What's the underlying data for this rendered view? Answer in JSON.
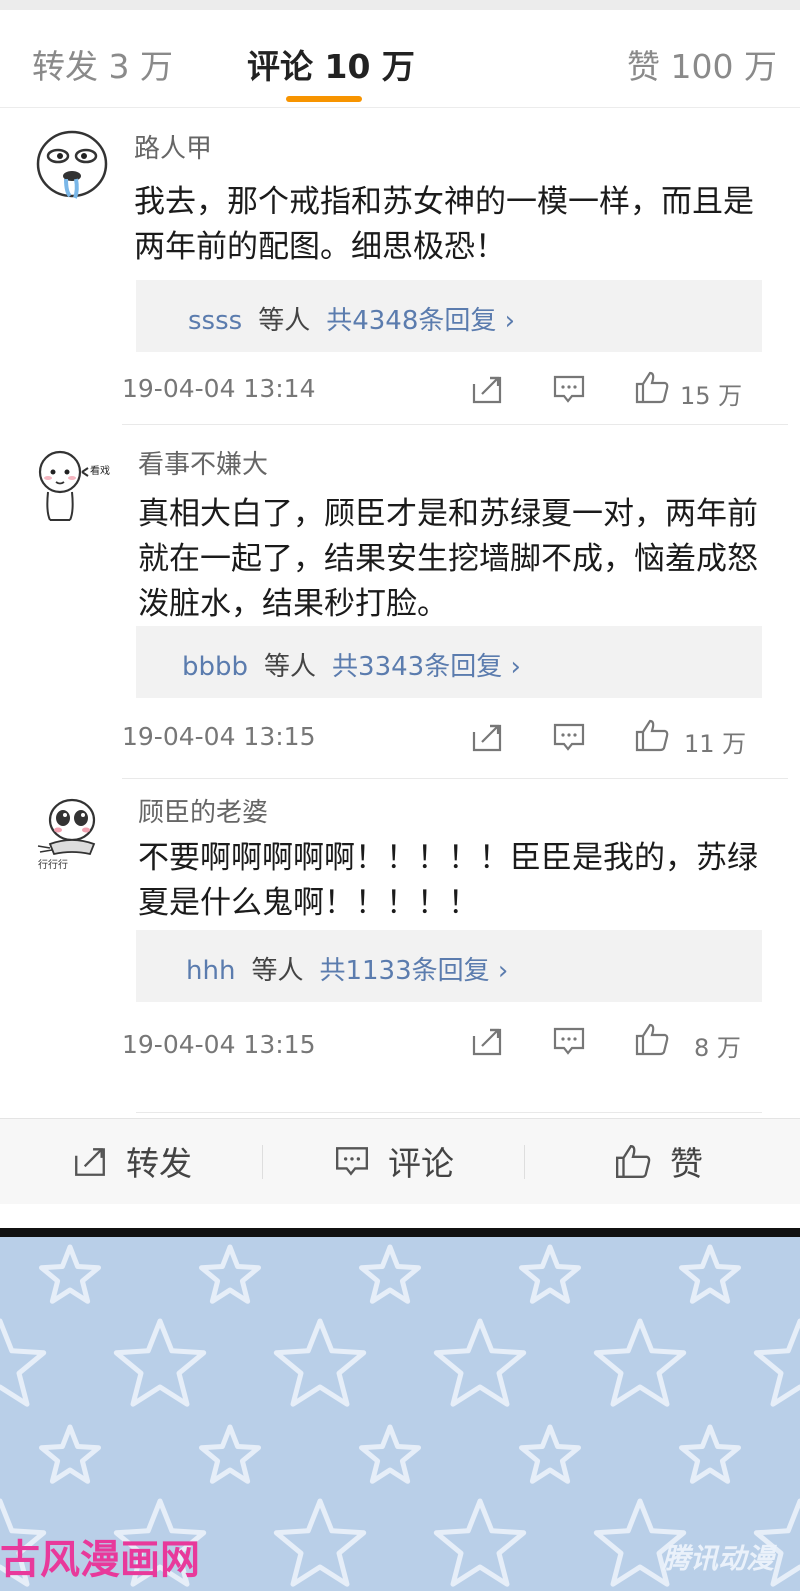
{
  "tabs": {
    "repost": "转发  3  万",
    "comment": "评论 10 万",
    "like": "赞 100  万",
    "accent": "#f79400"
  },
  "comments": [
    {
      "user": "路人甲",
      "avatar_icon": "drooling-face-icon",
      "text": "我去，那个戒指和苏女神的一模一样，而且是两年前的配图。细思极恐！",
      "reply_user": "ssss",
      "reply_others": "等人",
      "reply_count": "共4348条回复 ›",
      "time": "19-04-04  13:14",
      "likes": "15 万"
    },
    {
      "user": "看事不嫌大",
      "avatar_icon": "watching-show-face-icon",
      "avatar_caption": "看戏",
      "text": "真相大白了，顾臣才是和苏绿夏一对，两年前就在一起了，结果安生挖墙脚不成，恼羞成怒泼脏水，结果秒打脸。",
      "reply_user": "bbbb",
      "reply_others": "等人",
      "reply_count": "共3343条回复 ›",
      "time": "19-04-04  13:15",
      "likes": "11 万"
    },
    {
      "user": "顾臣的老婆",
      "avatar_icon": "crying-face-icon",
      "avatar_caption": "行行行",
      "text": "不要啊啊啊啊啊！！！！！臣臣是我的，苏绿夏是什么鬼啊！！！！！",
      "reply_user": "hhh",
      "reply_others": "等人",
      "reply_count": "共1133条回复 ›",
      "time": "19-04-04  13:15",
      "likes": "8 万"
    }
  ],
  "bottom_bar": {
    "repost": "转发",
    "comment": "评论",
    "like": "赞"
  },
  "panel": {
    "background": "#b9cfe8",
    "watermark": "古风漫画网",
    "watermark_color": "#e8399b",
    "publisher_mark": "腾讯动漫"
  }
}
